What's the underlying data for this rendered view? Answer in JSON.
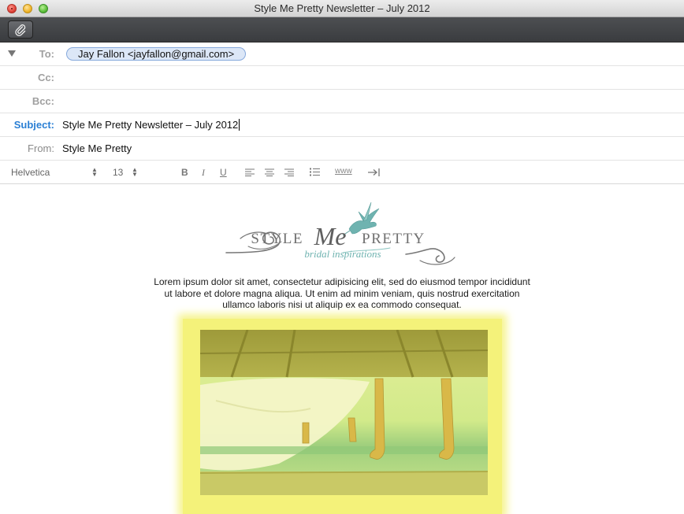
{
  "window": {
    "title": "Style Me Pretty Newsletter – July 2012"
  },
  "toolbar": {
    "attach_icon": "paperclip-icon"
  },
  "fields": {
    "to_label": "To:",
    "to_recipient": "Jay Fallon <jayfallon@gmail.com>",
    "cc_label": "Cc:",
    "cc_value": "",
    "bcc_label": "Bcc:",
    "bcc_value": "",
    "subject_label": "Subject:",
    "subject_value": "Style Me Pretty Newsletter – July 2012",
    "from_label": "From:",
    "from_value": "Style Me Pretty"
  },
  "format": {
    "font": "Helvetica",
    "size": "13",
    "bold": "B",
    "italic": "I",
    "underline": "U",
    "link": "www"
  },
  "message": {
    "logo": {
      "wordmark_left": "STYLE",
      "wordmark_script": "Me",
      "wordmark_right": "PRETTY",
      "tagline": "bridal inspirations"
    },
    "paragraph": "Lorem ipsum dolor sit amet, consectetur adipisicing elit, sed do eiusmod tempor incididunt ut labore et dolore magna aliqua. Ut enim ad minim veniam, quis nostrud exercitation ullamco laboris nisi ut aliquip ex ea commodo consequat."
  },
  "colors": {
    "label_blue": "#2a7fd4",
    "token_fill": "#dce7f7",
    "photo_glow": "#f4f27a",
    "logo_teal": "#6fb3b0"
  }
}
